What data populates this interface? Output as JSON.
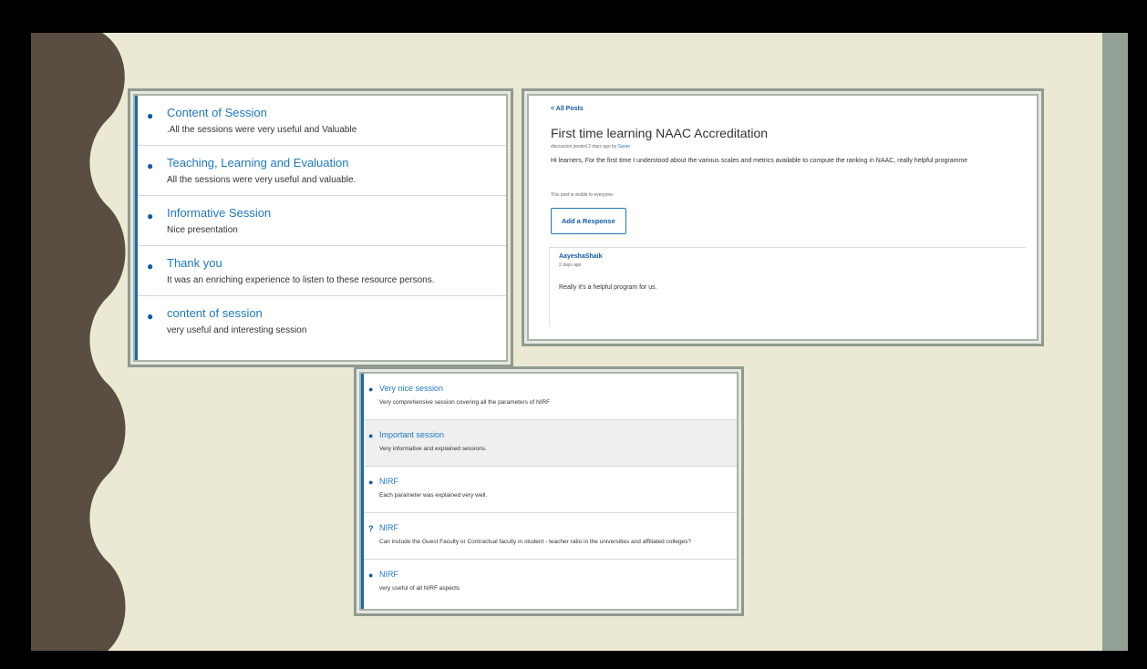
{
  "panel1": {
    "threads": [
      {
        "title": "Content of Session",
        "body": ".All the sessions were very useful and Valuable"
      },
      {
        "title": "Teaching, Learning and Evaluation",
        "body": "All the sessions were very useful and valuable."
      },
      {
        "title": "Informative Session",
        "body": "Nice presentation"
      },
      {
        "title": "Thank you",
        "body": "It was an enriching experience to listen to these resource persons."
      },
      {
        "title": "content of session",
        "body": "very useful and interesting session"
      }
    ]
  },
  "panel2": {
    "back_link": "< All Posts",
    "title": "First time learning NAAC Accreditation",
    "meta_prefix": "discussion posted 2 days ago by",
    "meta_author": "Saran",
    "body": "Hi learners, For the first time I understood about the various scales and metrics available to compute the ranking in NAAC, really helpful programme",
    "visibility": "This post is visible to everyone.",
    "add_response": "Add a Response",
    "response": {
      "author": "AayeshaShaik",
      "time": "2 days ago",
      "body": "Really it's a helpful program for us."
    }
  },
  "panel3": {
    "threads": [
      {
        "title": "Very nice session",
        "body": "Very comprehensive session covering all the parameters of NIRF",
        "icon": "comments-icon"
      },
      {
        "title": "Important session",
        "body": "Very informative and explained sessions.",
        "icon": "comments-icon"
      },
      {
        "title": "NIRF",
        "body": "Each parameter was explained very well.",
        "icon": "comments-icon"
      },
      {
        "title": "NIRF",
        "body": "Can include the Guest Faculty or Contractual faculty in student - teacher ratio in the universities and affiliated colleges?",
        "icon": "question-icon"
      },
      {
        "title": "NIRF",
        "body": "very useful of all NIRF aspects",
        "icon": "comments-icon"
      }
    ]
  },
  "colors": {
    "slide_background": "#ebe9d3",
    "wave_band": "#5a4e42",
    "right_band": "#93a196",
    "frame": "#8f9b8f",
    "link_blue": "#1f78c1",
    "accent_border": "#0f6db5"
  }
}
